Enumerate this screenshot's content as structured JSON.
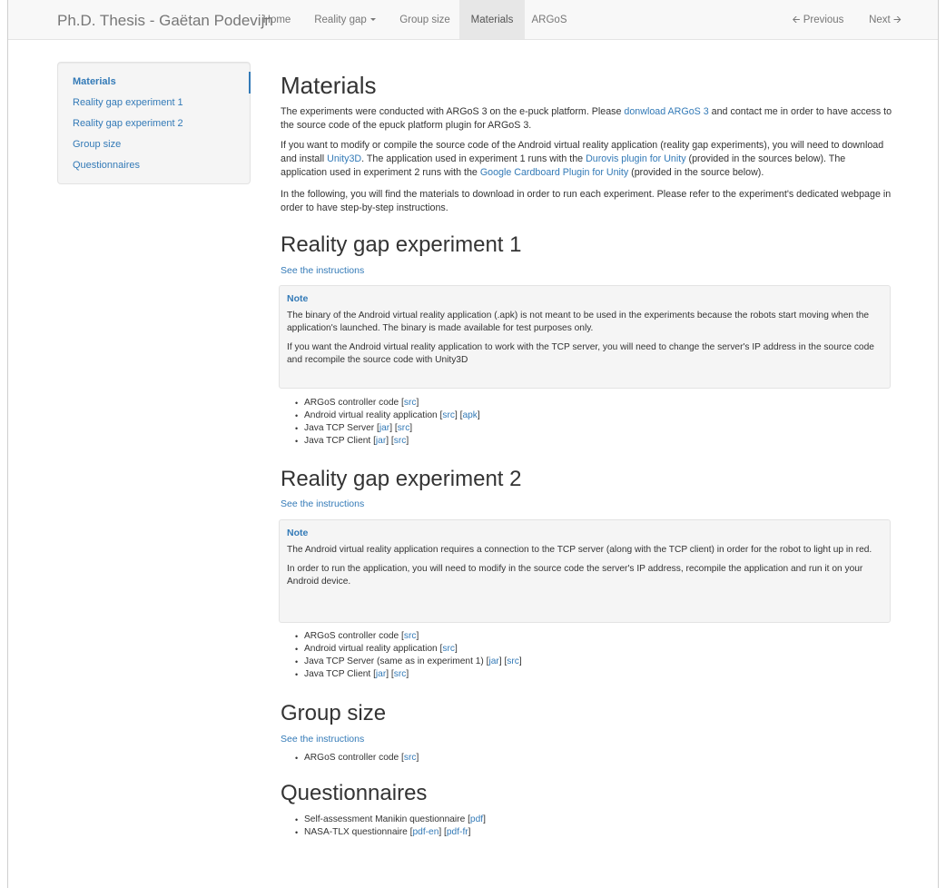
{
  "navbar": {
    "brand": "Ph.D. Thesis - Gaëtan Podevijn",
    "items": [
      {
        "label": "Home"
      },
      {
        "label": "Reality gap"
      },
      {
        "label": "Group size"
      },
      {
        "label": "Materials"
      },
      {
        "label": "ARGoS"
      }
    ],
    "previous": "Previous",
    "next": "Next",
    "previous_icon": "arrow-left-icon",
    "next_icon": "arrow-right-icon"
  },
  "sidenav": {
    "items": [
      {
        "label": "Materials"
      },
      {
        "label": "Reality gap experiment 1"
      },
      {
        "label": "Reality gap experiment 2"
      },
      {
        "label": "Group size"
      },
      {
        "label": "Questionnaires"
      }
    ]
  },
  "page": {
    "title": "Materials",
    "intro1": {
      "t1": "The experiments were conducted with ARGoS 3 on the e-puck platform. Please ",
      "link1": "donwload ARGoS 3",
      "t2": " and contact me in order to have access to the source code of the epuck platform plugin for ARGoS 3."
    },
    "intro2": {
      "t1": "If you want to modify or compile the source code of the Android virtual reality application (reality gap experiments), you will need to download and install ",
      "link1": "Unity3D",
      "t2": ". The application used in experiment 1 runs with the ",
      "link2": "Durovis plugin for Unity",
      "t3": " (provided in the sources below). The application used in experiment 2 runs with the ",
      "link3": "Google Cardboard Plugin for Unity",
      "t4": " (provided in the source below)."
    },
    "intro3": "In the following, you will find the materials to download in order to run each experiment. Please refer to the experiment's dedicated webpage in order to have step-by-step instructions."
  },
  "exp1": {
    "heading": "Reality gap experiment 1",
    "instructions": "See the instructions",
    "note_title": "Note",
    "note_p1": "The binary of the Android virtual reality application (.apk) is not meant to be used in the experiments because the robots start moving when the application's launched. The binary is made available for test purposes only.",
    "note_p2": "If you want the Android virtual reality application to work with the TCP server, you will need to change the server's IP address in the source code and recompile the source code with Unity3D",
    "items": [
      {
        "text": "ARGoS controller code ",
        "links": [
          "src"
        ]
      },
      {
        "text": "Android virtual reality application ",
        "links": [
          "src",
          "apk"
        ]
      },
      {
        "text": "Java TCP Server ",
        "links": [
          "jar",
          "src"
        ]
      },
      {
        "text": "Java TCP Client ",
        "links": [
          "jar",
          "src"
        ]
      }
    ]
  },
  "exp2": {
    "heading": "Reality gap experiment 2",
    "instructions": "See the instructions",
    "note_title": "Note",
    "note_p1": "The Android virtual reality application requires a connection to the TCP server (along with the TCP client) in order for the robot to light up in red.",
    "note_p2": "In order to run the application, you will need to modify in the source code the server's IP address, recompile the application and run it on your Android device.",
    "items": [
      {
        "text": "ARGoS controller code ",
        "links": [
          "src"
        ]
      },
      {
        "text": "Android virtual reality application ",
        "links": [
          "src"
        ]
      },
      {
        "text": "Java TCP Server (same as in experiment 1) ",
        "links": [
          "jar",
          "src"
        ]
      },
      {
        "text": "Java TCP Client ",
        "links": [
          "jar",
          "src"
        ]
      }
    ]
  },
  "group": {
    "heading": "Group size",
    "instructions": "See the instructions",
    "items": [
      {
        "text": "ARGoS controller code ",
        "links": [
          "src"
        ]
      }
    ]
  },
  "quest": {
    "heading": "Questionnaires",
    "items": [
      {
        "text": "Self-assessment Manikin questionnaire ",
        "links": [
          "pdf"
        ]
      },
      {
        "text": "NASA-TLX questionnaire ",
        "links": [
          "pdf-en",
          "pdf-fr"
        ]
      }
    ]
  }
}
